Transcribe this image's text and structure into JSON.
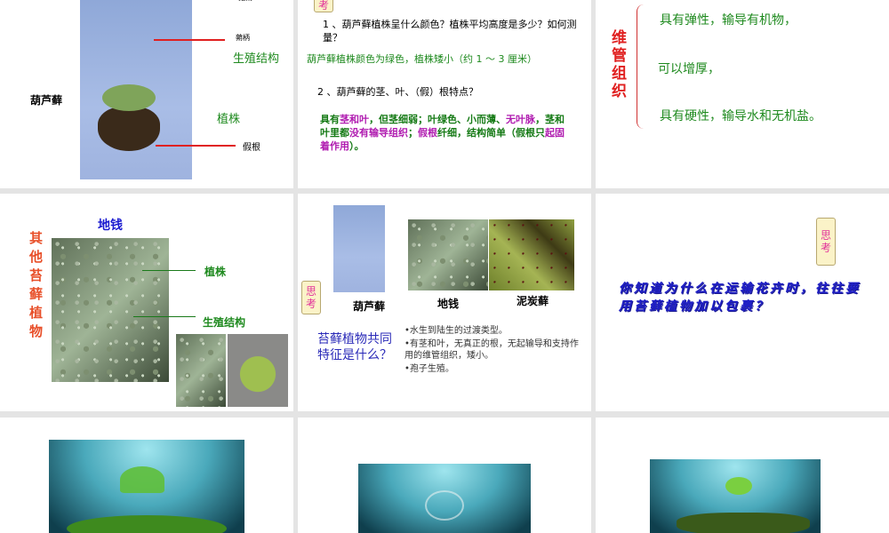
{
  "slide1": {
    "plant_name": "葫芦藓",
    "top_label": "孢蒴",
    "stalk": "蒴柄",
    "repro": "生殖结构",
    "plant": "植株",
    "rhizoid": "假根"
  },
  "slide2": {
    "think_icon": "考",
    "q1": "1 、葫芦藓植株呈什么颜色？植株平均高度是多少？如何测量？",
    "a1": "葫芦藓植株颜色为绿色，植株矮小（约 1 ～ 3 厘米）",
    "q2": "2 、葫芦藓的茎、叶、（假）根特点？",
    "a2": [
      {
        "t": "具有",
        "c": "#157a15"
      },
      {
        "t": "茎和叶",
        "c": "#b01cb0"
      },
      {
        "t": "，但茎细弱；叶绿色、小而薄、",
        "c": "#157a15"
      },
      {
        "t": "无叶脉",
        "c": "#b01cb0"
      },
      {
        "t": "，茎和叶里都",
        "c": "#157a15"
      },
      {
        "t": "没有输导组织",
        "c": "#b01cb0"
      },
      {
        "t": "；",
        "c": "#157a15"
      },
      {
        "t": "假根",
        "c": "#b01cb0"
      },
      {
        "t": "纤细，结构简单（假根只",
        "c": "#157a15"
      },
      {
        "t": "起固着作用",
        "c": "#b01cb0"
      },
      {
        "t": "）。",
        "c": "#157a15"
      }
    ]
  },
  "slide3": {
    "title": "维管组织",
    "items": [
      "具有弹性，输导有机物，",
      "可以增厚，",
      "具有硬性，输导水和无机盐。"
    ]
  },
  "slide4": {
    "title": "其他苔藓植物",
    "caption": "地钱",
    "plant": "植株",
    "repro": "生殖结构"
  },
  "slide5": {
    "names": [
      "葫芦藓",
      "地钱",
      "泥炭藓"
    ],
    "think_icon": "思考",
    "question": "苔藓植物共同特征是什么？",
    "bullets": [
      "•水生到陆生的过渡类型。",
      "•有茎和叶，无真正的根，无起输导和支持作用的维管组织，矮小。",
      "•孢子生殖。"
    ]
  },
  "slide6": {
    "think_icon": "思考",
    "question": "你知道为什么在运输花卉时，往往要用苔藓植物加以包裹？"
  }
}
